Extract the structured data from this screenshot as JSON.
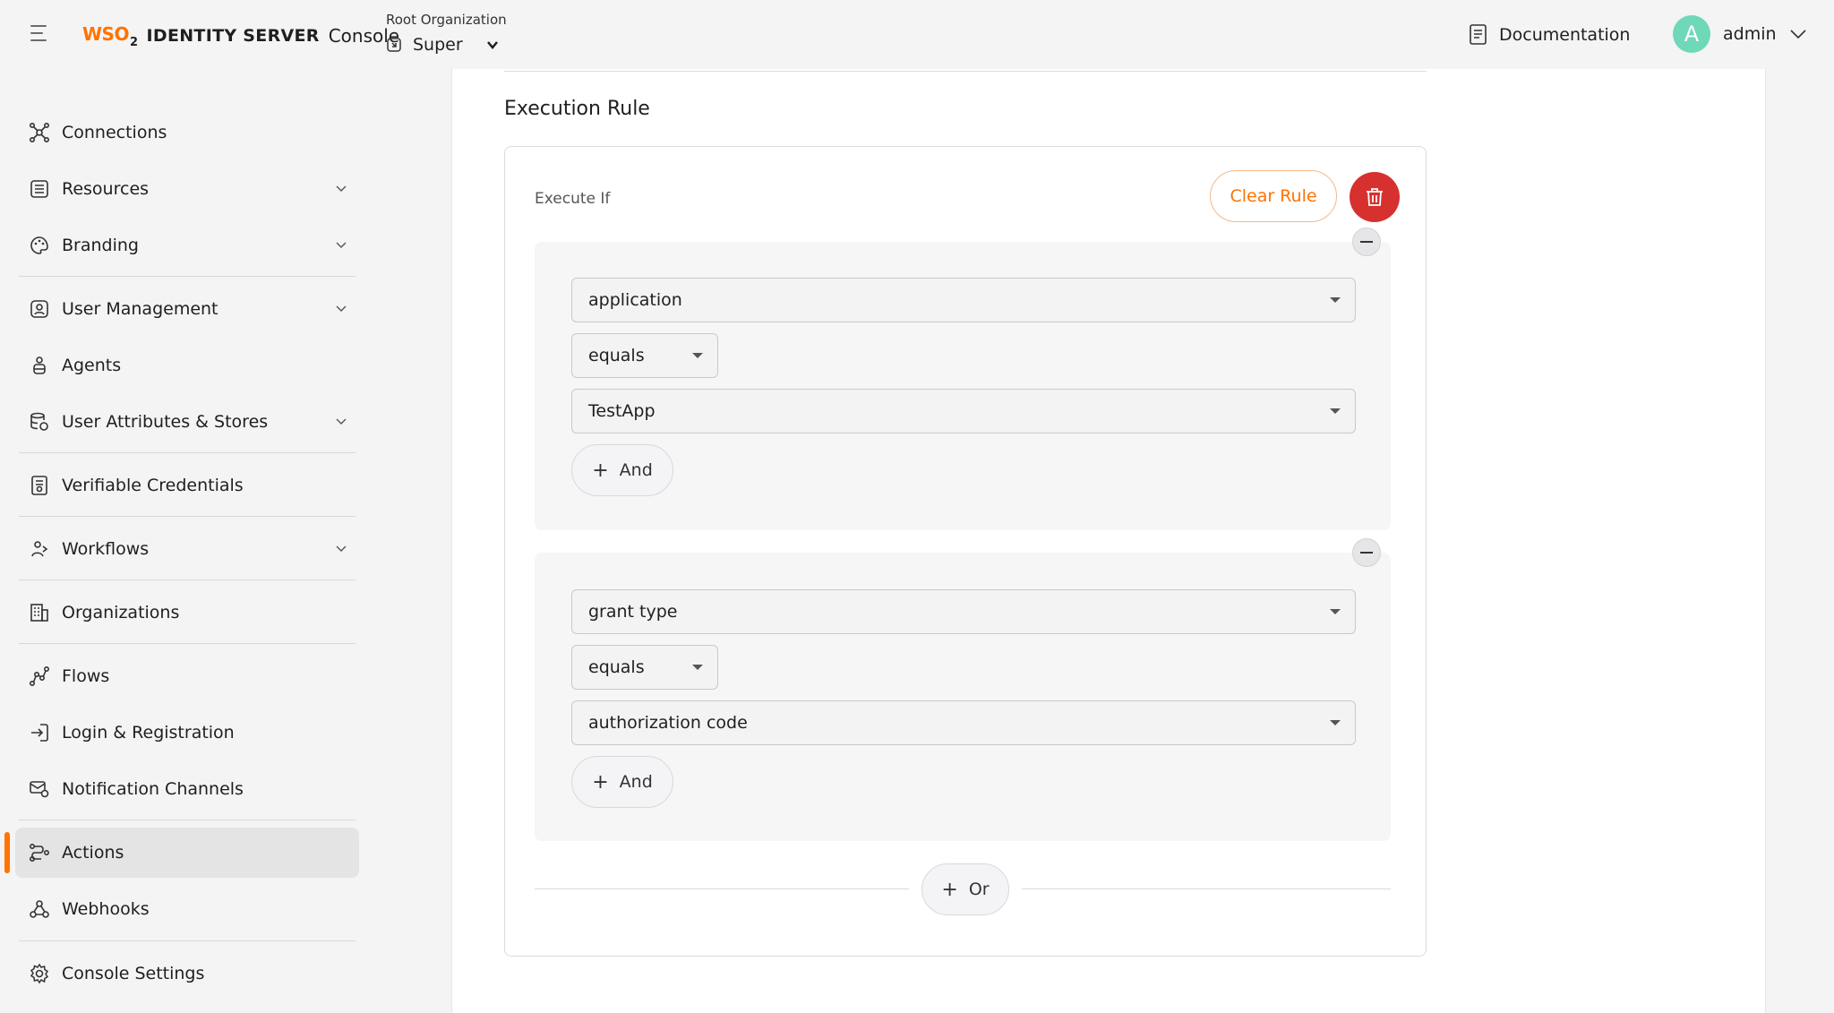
{
  "header": {
    "brand_wso": "WSO",
    "brand_two": "2",
    "brand_product": "IDENTITY SERVER",
    "brand_console": "Console",
    "org_label": "Root Organization",
    "org_name": "Super",
    "docs_label": "Documentation",
    "avatar_letter": "A",
    "username": "admin",
    "icons": [
      "menu-icon",
      "organization-icon",
      "chevron-down-icon",
      "document-icon",
      "chevron-down-icon"
    ]
  },
  "sidebar": {
    "items": [
      {
        "label": "Connections",
        "icon": "connections-icon",
        "expandable": false
      },
      {
        "label": "Resources",
        "icon": "resources-icon",
        "expandable": true
      },
      {
        "label": "Branding",
        "icon": "palette-icon",
        "expandable": true
      },
      {
        "label": "User Management",
        "icon": "user-management-icon",
        "expandable": true
      },
      {
        "label": "Agents",
        "icon": "agent-icon",
        "expandable": false
      },
      {
        "label": "User Attributes & Stores",
        "icon": "database-icon",
        "expandable": true
      },
      {
        "label": "Verifiable Credentials",
        "icon": "credential-icon",
        "expandable": false
      },
      {
        "label": "Workflows",
        "icon": "workflow-icon",
        "expandable": true
      },
      {
        "label": "Organizations",
        "icon": "building-icon",
        "expandable": false
      },
      {
        "label": "Flows",
        "icon": "flow-icon",
        "expandable": false
      },
      {
        "label": "Login & Registration",
        "icon": "login-icon",
        "expandable": false
      },
      {
        "label": "Notification Channels",
        "icon": "notification-icon",
        "expandable": false
      },
      {
        "label": "Actions",
        "icon": "actions-icon",
        "expandable": false,
        "active": true
      },
      {
        "label": "Webhooks",
        "icon": "webhook-icon",
        "expandable": false
      },
      {
        "label": "Console Settings",
        "icon": "gear-icon",
        "expandable": false
      }
    ],
    "active_color": "#ff7300"
  },
  "main": {
    "section_title": "Execution Rule",
    "execute_if_label": "Execute If",
    "clear_rule_label": "Clear Rule",
    "delete_icon": "trash-icon",
    "conditions": [
      {
        "field": "application",
        "operator": "equals",
        "value": "TestApp",
        "and_label": "And"
      },
      {
        "field": "grant type",
        "operator": "equals",
        "value": "authorization code",
        "and_label": "And"
      }
    ],
    "or_label": "Or",
    "accent_color": "#ff7300",
    "delete_color": "#d6312f"
  }
}
